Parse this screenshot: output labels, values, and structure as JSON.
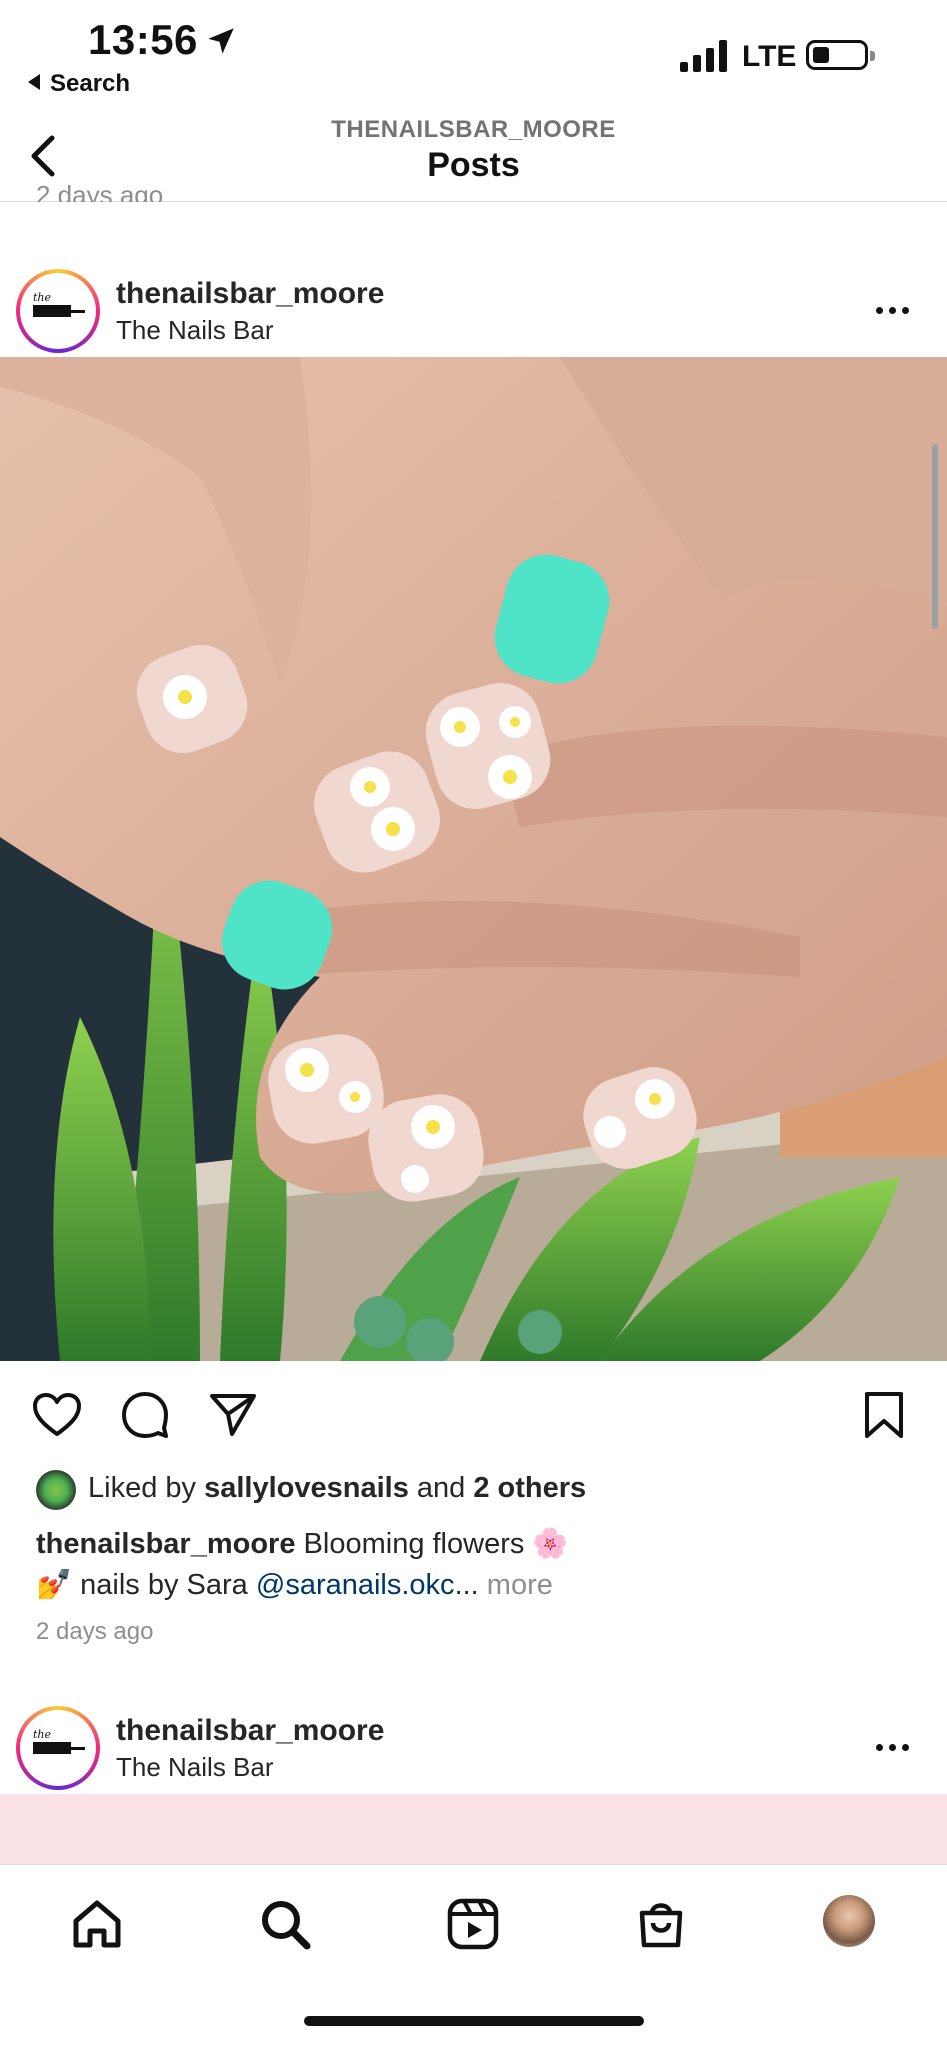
{
  "status_bar": {
    "time": "13:56",
    "back_app": "Search",
    "carrier": "LTE",
    "battery_level": 0.3
  },
  "nav": {
    "account": "THENAILSBAR_MOORE",
    "title": "Posts"
  },
  "previous_post": {
    "timestamp_cut": "2 days ago"
  },
  "post": {
    "username": "thenailsbar_moore",
    "location": "The Nails Bar",
    "avatar_text": "the NAILS BAR",
    "likes": {
      "prefix": "Liked by",
      "user": "sallylovesnails",
      "joiner": "and",
      "others": "2 others"
    },
    "caption": {
      "username": "thenailsbar_moore",
      "text": "Blooming flowers 🌸",
      "line2_prefix": "💅 nails by Sara",
      "mention": "@saranails.okc",
      "ellipsis": "...",
      "more": "more"
    },
    "timestamp": "2 days ago"
  },
  "next_post": {
    "username": "thenailsbar_moore",
    "location": "The Nails Bar"
  },
  "icons": {
    "like": "heart-icon",
    "comment": "comment-icon",
    "share": "paper-plane-icon",
    "save": "bookmark-icon",
    "home": "home-icon",
    "search": "search-icon",
    "reels": "reels-icon",
    "shop": "shop-icon"
  },
  "colors": {
    "mention": "#00376b",
    "muted": "#8e8e8e",
    "nail_teal": "#4fe3c8"
  }
}
